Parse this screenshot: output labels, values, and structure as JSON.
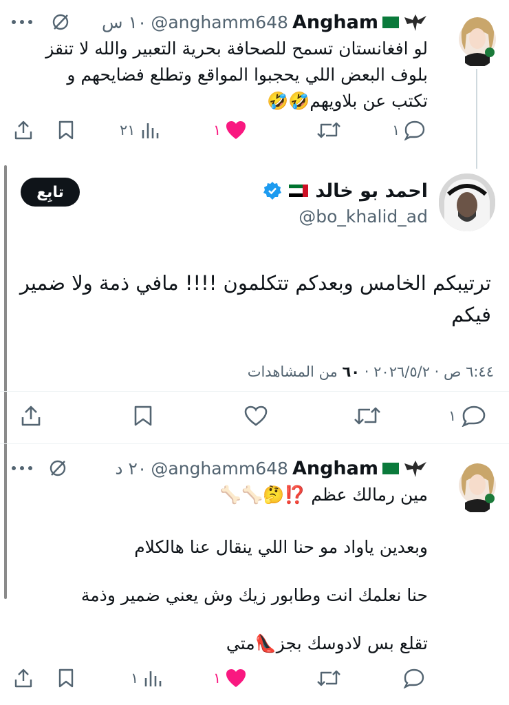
{
  "tweet1": {
    "display_name": "Angham",
    "handle": "@anghamm648",
    "time": "١٠ س",
    "text_lines": [
      "لو افغانستان تسمح للصحافة بحرية التعبير والله لا تنقز",
      "بلوف البعض اللي يحجبوا المواقع وتطلع فضايحهم و",
      "تكتب عن بلاويهم🤣🤣"
    ],
    "replies": "١",
    "likes": "١",
    "views": "٢١"
  },
  "main": {
    "display_name": "احمد بو خالد",
    "handle": "@bo_khalid_ad",
    "follow_label": "تابِع",
    "text_lines": [
      "ترتيبكم الخامس وبعدكم تتكلمون !!!! مافي ذمة ولا ضمير",
      "فيكم"
    ],
    "meta": "٦:٤٤ ص · ٢٠٢٦/٥/٢ · ",
    "views_count": "٦٠",
    "views_label": " من المشاهدات",
    "replies": "١"
  },
  "tweet2": {
    "display_name": "Angham",
    "handle": "@anghamm648",
    "time": "٢٠ د",
    "text_lines": [
      "مين رمالك عظم ⁉️🤔🦴🦴",
      "وبعدين ياواد مو حنا اللي ينقال عنا هالكلام",
      "حنا نعلمك انت وطابور زيك وش يعني ضمير وذمة",
      "تقلع بس لادوسك بجز👠متي"
    ],
    "likes": "١",
    "views": "١"
  },
  "colors": {
    "like": "#f91880",
    "verified": "#1d9bf0",
    "muted": "#536471",
    "divider": "#eff3f4"
  }
}
